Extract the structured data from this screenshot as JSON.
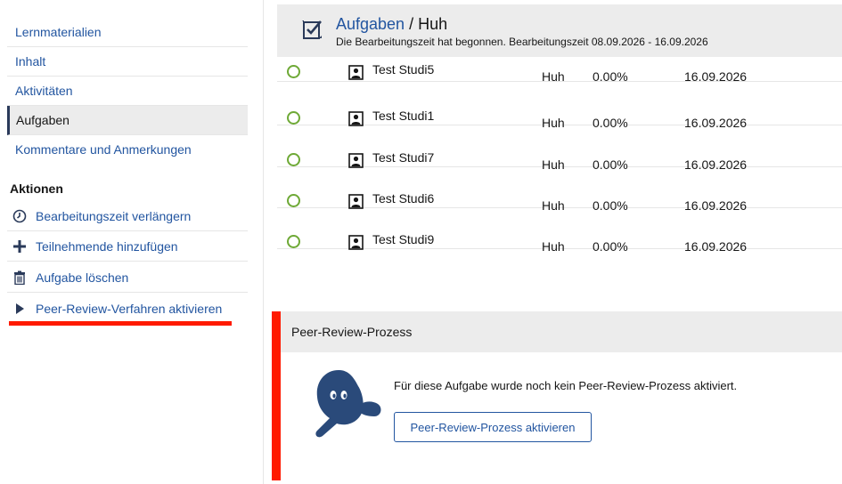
{
  "sidebar": {
    "nav": [
      "Lernmaterialien",
      "Inhalt",
      "Aktivitäten",
      "Aufgaben",
      "Kommentare und Anmerkungen"
    ],
    "active_index": 3,
    "actions_title": "Aktionen",
    "actions": [
      {
        "label": "Bearbeitungszeit verlängern",
        "icon": "clock-icon"
      },
      {
        "label": "Teilnehmende hinzufügen",
        "icon": "plus-icon"
      },
      {
        "label": "Aufgabe löschen",
        "icon": "trash-icon"
      },
      {
        "label": "Peer-Review-Verfahren aktivieren",
        "icon": "play-icon"
      }
    ]
  },
  "header": {
    "title_link": "Aufgaben",
    "title_rest": " / Huh",
    "subtitle": "Die Bearbeitungszeit hat begonnen. Bearbeitungszeit 08.09.2026 - 16.09.2026"
  },
  "rows": [
    {
      "name": "Test Studi5",
      "task": "Huh",
      "percent": "0.00%",
      "date": "16.09.2026"
    },
    {
      "name": "Test Studi1",
      "task": "Huh",
      "percent": "0.00%",
      "date": "16.09.2026"
    },
    {
      "name": "Test Studi7",
      "task": "Huh",
      "percent": "0.00%",
      "date": "16.09.2026"
    },
    {
      "name": "Test Studi6",
      "task": "Huh",
      "percent": "0.00%",
      "date": "16.09.2026"
    },
    {
      "name": "Test Studi9",
      "task": "Huh",
      "percent": "0.00%",
      "date": "16.09.2026"
    }
  ],
  "peer_review": {
    "title": "Peer-Review-Prozess",
    "message": "Für diese Aufgabe wurde noch kein Peer-Review-Prozess aktiviert.",
    "button": "Peer-Review-Prozess aktivieren"
  },
  "colors": {
    "link": "#2255a0",
    "accent_green": "#6ea936",
    "highlight_red": "#ff1a00"
  }
}
